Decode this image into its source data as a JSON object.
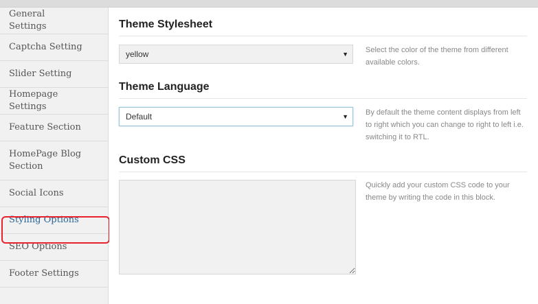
{
  "sidebar": {
    "items": [
      {
        "label": "General Settings"
      },
      {
        "label": "Captcha Setting"
      },
      {
        "label": "Slider Setting"
      },
      {
        "label": "Homepage Settings"
      },
      {
        "label": "Feature Section"
      },
      {
        "label": "HomePage Blog Section"
      },
      {
        "label": "Social Icons"
      },
      {
        "label": "Styling Options"
      },
      {
        "label": "SEO Options"
      },
      {
        "label": "Footer Settings"
      }
    ],
    "active": "Styling Options"
  },
  "main": {
    "theme_stylesheet": {
      "title": "Theme Stylesheet",
      "selected": "yellow",
      "description": "Select the color of the theme from different available colors."
    },
    "theme_language": {
      "title": "Theme Language",
      "selected": "Default",
      "description": "By default the theme content displays from left to right which you can change to right to left i.e. switching it to RTL."
    },
    "custom_css": {
      "title": "Custom CSS",
      "value": "",
      "description": "Quickly add your custom CSS code to your theme by writing the code in this block."
    }
  },
  "colors": {
    "active_link": "#2a6496",
    "highlight_border": "#e8212c"
  }
}
